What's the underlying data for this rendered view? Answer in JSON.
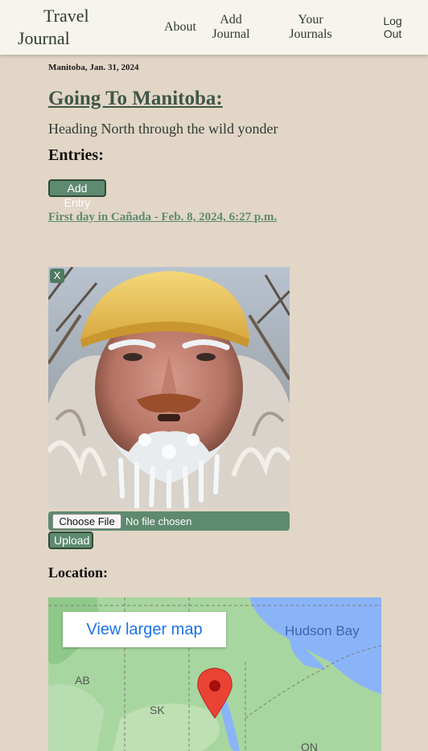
{
  "nav": {
    "brand_line1": "Travel",
    "brand_line2": "Journal",
    "about": "About",
    "add_journal_line1": "Add",
    "add_journal_line2": "Journal",
    "your_journals_line1": "Your",
    "your_journals_line2": "Journals",
    "logout_line1": "Log",
    "logout_line2": "Out"
  },
  "journal": {
    "date": "Manitoba, Jan. 31, 2024",
    "title": "Going To Manitoba:",
    "description": "Heading North through the wild yonder",
    "entries_heading": "Entries:",
    "add_entry_label": "Add Entry",
    "entries": [
      {
        "label": "First day in Cañada - Feb. 8, 2024, 6:27 p.m."
      }
    ]
  },
  "photo": {
    "close_label": "X"
  },
  "upload": {
    "choose_file_label": "Choose File",
    "no_file_text": "No file chosen",
    "upload_label": "Upload"
  },
  "location": {
    "heading": "Location:",
    "larger_map_label": "View larger map",
    "labels": {
      "hudson_bay": "Hudson Bay",
      "ab": "AB",
      "sk": "SK",
      "on": "ON"
    }
  },
  "colors": {
    "page_background": "#e2d6c6",
    "header_background": "#f6f4ed",
    "accent_green": "#5e8a70",
    "title_green": "#3f5748",
    "map_land": "#a8d6a0",
    "map_water": "#8ab4f8",
    "map_pin": "#ea4335"
  }
}
